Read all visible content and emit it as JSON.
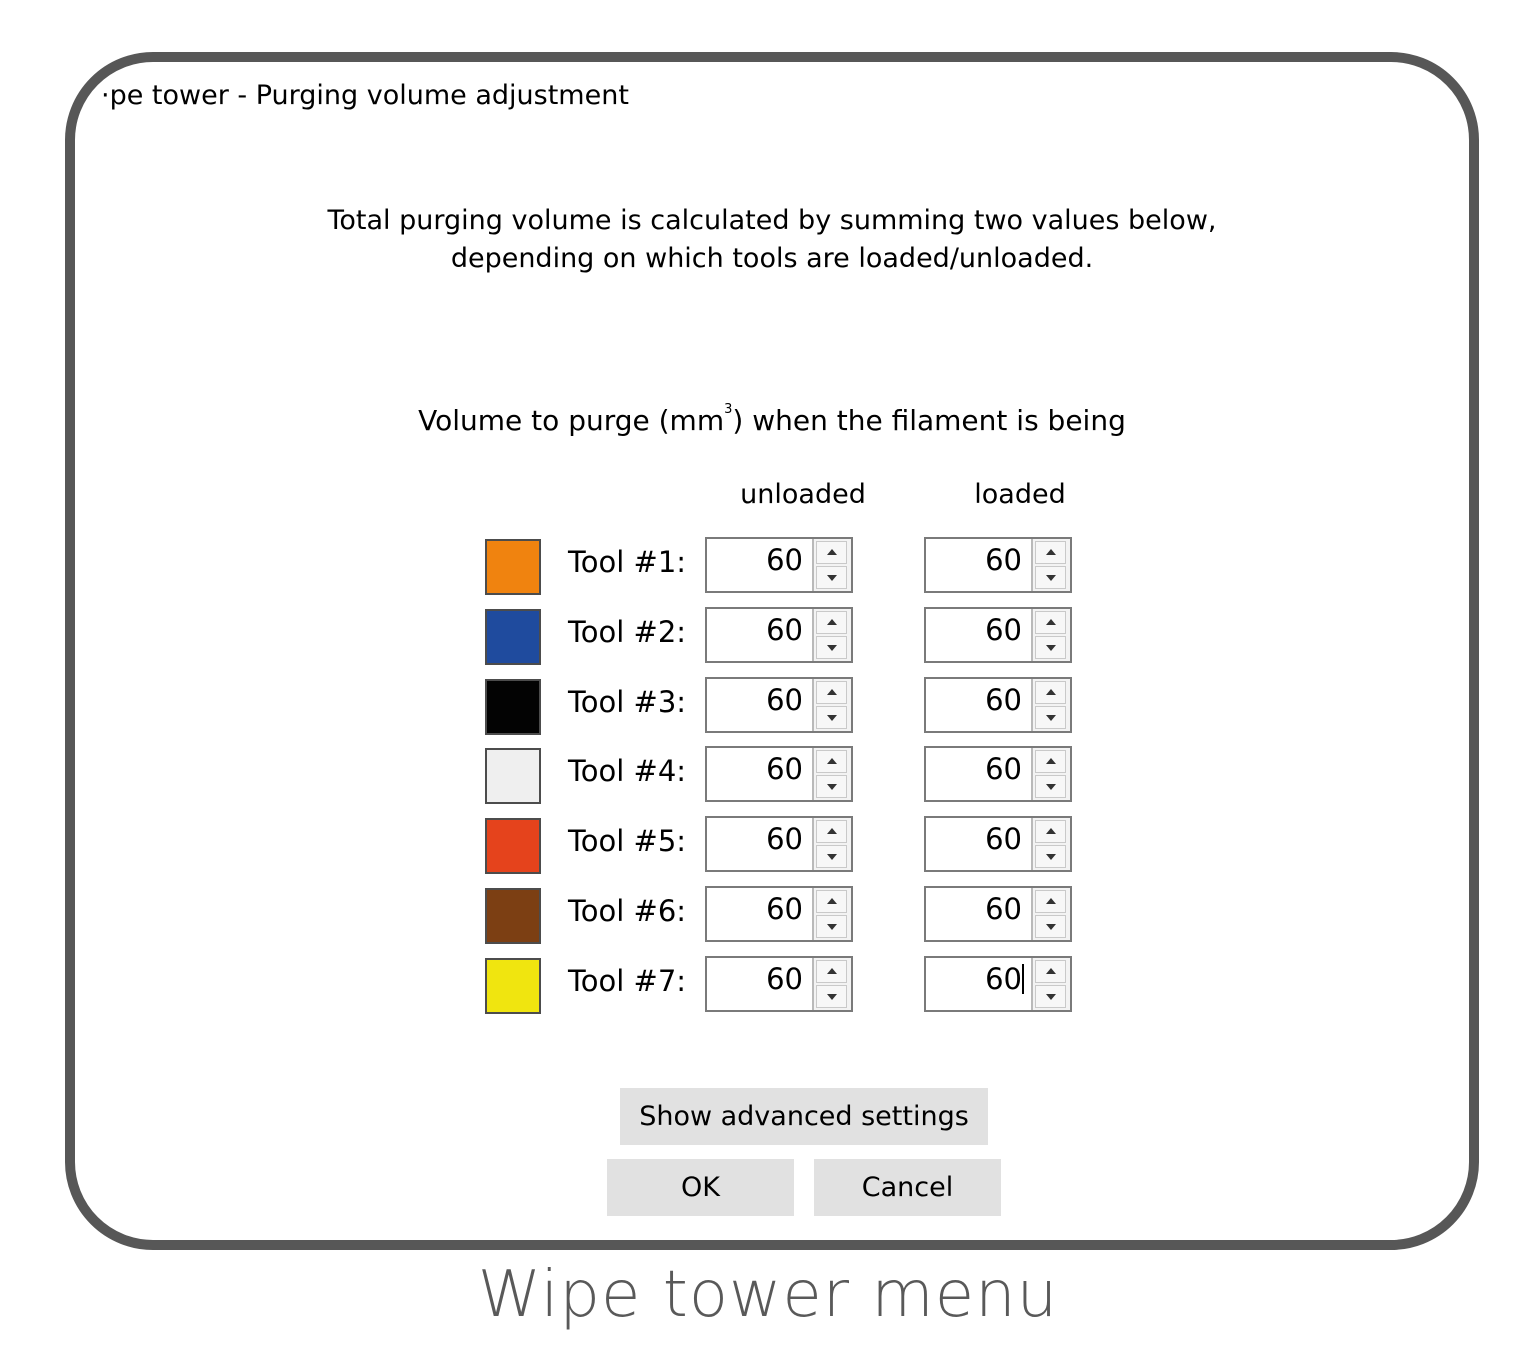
{
  "window": {
    "title": "·pe tower - Purging volume adjustment"
  },
  "description": {
    "line1": "Total purging volume is calculated by summing two values below,",
    "line2": "depending on which tools are loaded/unloaded."
  },
  "volume_label": {
    "text_before": "Volume to purge (mm",
    "superscript": "3",
    "text_after": ") when the filament is being"
  },
  "columns": {
    "unloaded": "unloaded",
    "loaded": "loaded"
  },
  "tools": [
    {
      "label": "Tool #1:",
      "color": "#f0830f",
      "unloaded": "60",
      "loaded": "60"
    },
    {
      "label": "Tool #2:",
      "color": "#1f4b9e",
      "unloaded": "60",
      "loaded": "60"
    },
    {
      "label": "Tool #3:",
      "color": "#030303",
      "unloaded": "60",
      "loaded": "60"
    },
    {
      "label": "Tool #4:",
      "color": "#efefef",
      "unloaded": "60",
      "loaded": "60"
    },
    {
      "label": "Tool #5:",
      "color": "#e5431c",
      "unloaded": "60",
      "loaded": "60"
    },
    {
      "label": "Tool #6:",
      "color": "#7c3f13",
      "unloaded": "60",
      "loaded": "60"
    },
    {
      "label": "Tool #7:",
      "color": "#f0e50f",
      "unloaded": "60",
      "loaded": "60"
    }
  ],
  "buttons": {
    "advanced": "Show advanced settings",
    "ok": "OK",
    "cancel": "Cancel"
  },
  "caption": "Wipe tower menu"
}
